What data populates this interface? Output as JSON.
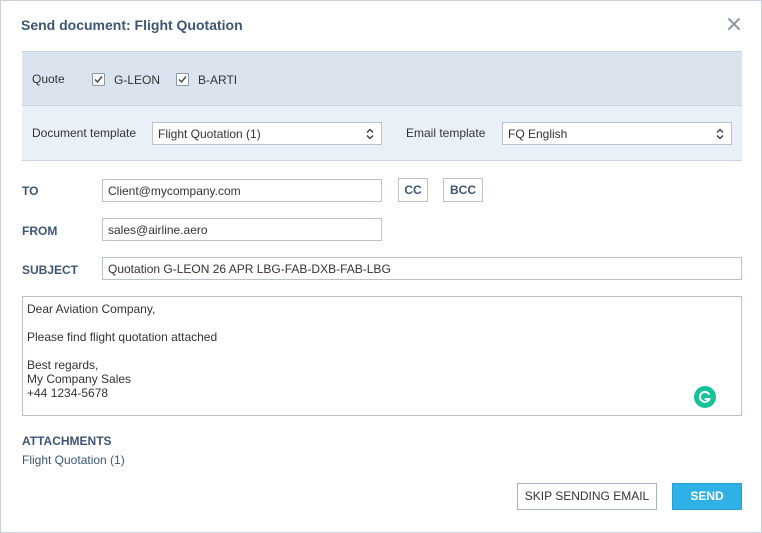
{
  "dialog": {
    "title": "Send document: Flight Quotation"
  },
  "quote": {
    "label": "Quote",
    "aircraft": [
      {
        "name": "G-LEON",
        "checked": true
      },
      {
        "name": "B-ARTI",
        "checked": true
      }
    ]
  },
  "templates": {
    "document_label": "Document template",
    "document_value": "Flight Quotation (1)",
    "email_label": "Email template",
    "email_value": "FQ English"
  },
  "email": {
    "to_label": "TO",
    "to_value": "Client@mycompany.com",
    "cc_label": "CC",
    "bcc_label": "BCC",
    "from_label": "FROM",
    "from_value": "sales@airline.aero",
    "subject_label": "SUBJECT",
    "subject_value": "Quotation G-LEON 26 APR LBG-FAB-DXB-FAB-LBG",
    "body_lines": [
      "Dear Aviation Company,",
      "",
      "Please find flight quotation attached",
      "",
      "Best regards,",
      "My Company Sales",
      "+44 1234-5678"
    ]
  },
  "attachments": {
    "label": "ATTACHMENTS",
    "items": [
      "Flight Quotation (1)"
    ]
  },
  "actions": {
    "skip_label": "SKIP SENDING EMAIL",
    "send_label": "SEND"
  },
  "colors": {
    "accent": "#3d5674",
    "send": "#2fb0e6",
    "band": "#dbe3ef",
    "grammarly": "#15c39a"
  }
}
